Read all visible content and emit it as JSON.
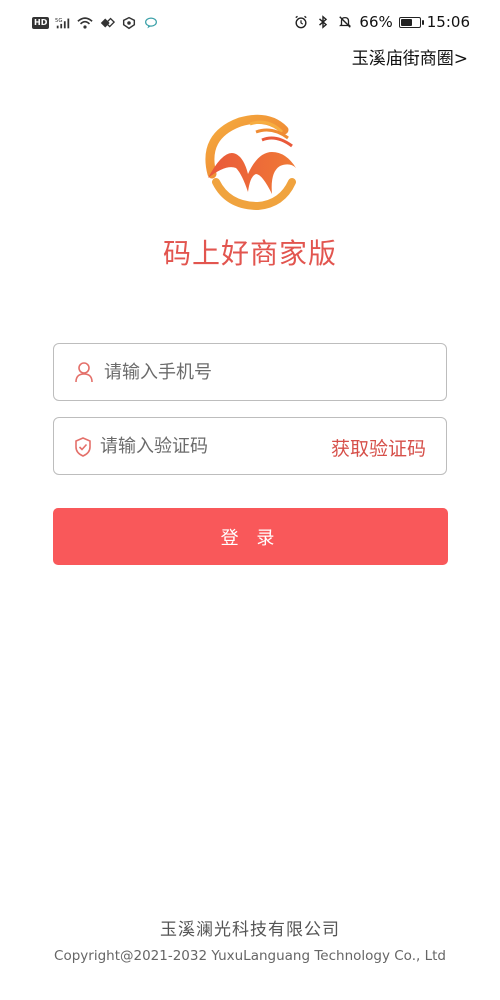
{
  "status_bar": {
    "hd_label": "HD",
    "network_label": "5G",
    "battery_percent_text": "66%",
    "battery_level": 0.66,
    "time": "15:06",
    "icons": [
      "signal-icon",
      "wifi-icon",
      "data-saver-icon",
      "shield-app-icon",
      "chat-bubble-icon",
      "alarm-icon",
      "bluetooth-icon",
      "mute-icon",
      "battery-icon"
    ]
  },
  "header": {
    "district_link": "玉溪庙街商圈>"
  },
  "app": {
    "title": "码上好商家版",
    "logo_icon": "brand-logo-m-icon",
    "brand_colors": [
      "#f2a03c",
      "#e8533a"
    ]
  },
  "form": {
    "phone_placeholder": "请输入手机号",
    "code_placeholder": "请输入验证码",
    "get_code_label": "获取验证码",
    "login_label": "登 录",
    "accent_color": "#f9585a"
  },
  "footer": {
    "company": "玉溪澜光科技有限公司",
    "copyright": "Copyright@2021-2032 YuxuLanguang Technology Co., Ltd"
  }
}
